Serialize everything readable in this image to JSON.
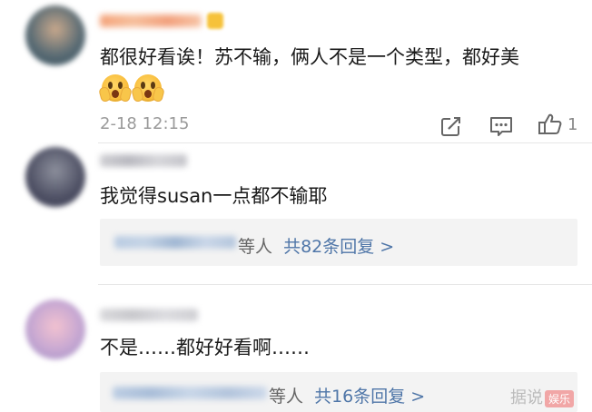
{
  "comments": [
    {
      "text": "都很好看诶！苏不输，俩人不是一个类型，都好美",
      "emojis": [
        "scared-face-emoji",
        "scared-face-emoji"
      ],
      "time": "2-18 12:15",
      "like_count": "1",
      "icons": [
        "share-icon",
        "comment-icon",
        "thumbs-up-icon"
      ]
    },
    {
      "text": "我觉得susan一点都不输耶",
      "reply_deng": "等人",
      "reply_more": "共82条回复 >"
    },
    {
      "text": "不是……都好好看啊……",
      "reply_deng": "等人",
      "reply_more": "共16条回复 >"
    }
  ],
  "watermark": {
    "text": "据说",
    "tag": "娱乐"
  },
  "colors": {
    "link": "#4f76a8",
    "time": "#9a9a9a",
    "reply_bg": "#f3f3f3"
  }
}
